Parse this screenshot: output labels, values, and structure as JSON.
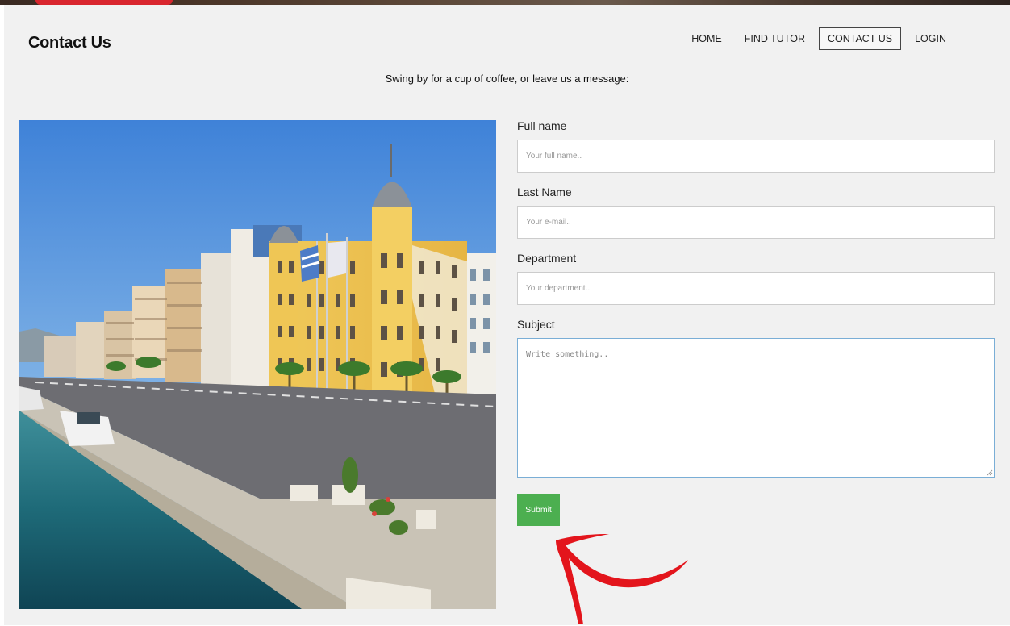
{
  "page": {
    "title": "Contact Us",
    "tagline": "Swing by for a cup of coffee, or leave us a message:"
  },
  "nav": {
    "items": [
      {
        "label": "HOME",
        "active": false
      },
      {
        "label": "FIND TUTOR",
        "active": false
      },
      {
        "label": "CONTACT US",
        "active": true
      },
      {
        "label": "LOGIN",
        "active": false
      }
    ]
  },
  "form": {
    "full_name": {
      "label": "Full name",
      "placeholder": "Your full name.."
    },
    "last_name": {
      "label": "Last Name",
      "placeholder": "Your e-mail.."
    },
    "department": {
      "label": "Department",
      "placeholder": "Your department.."
    },
    "subject": {
      "label": "Subject",
      "placeholder": "Write something.."
    },
    "submit_label": "Submit"
  },
  "colors": {
    "page_background": "#f1f1f1",
    "submit_button": "#4caf50",
    "annotation_arrow": "#e3151c",
    "textarea_focus_border": "#7aaed6"
  },
  "icons": {
    "annotation": "red-arrow-icon",
    "resize": "resize-grip-icon"
  }
}
